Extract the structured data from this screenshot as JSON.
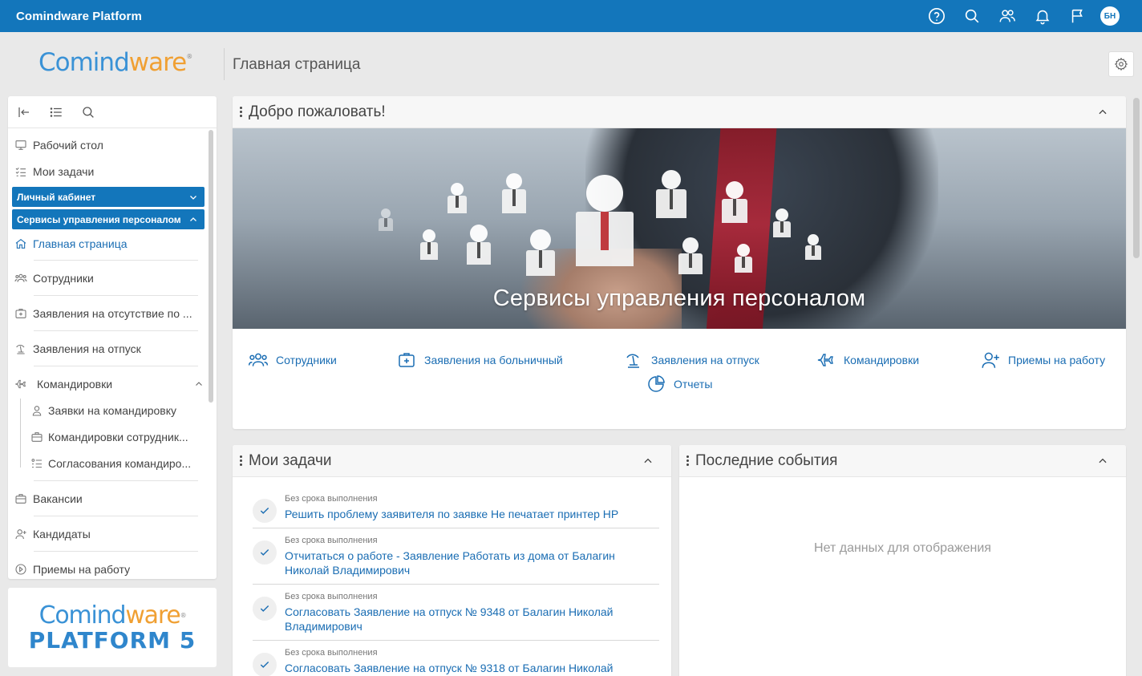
{
  "topbar": {
    "app_name": "Comindware Platform",
    "icons": [
      "help-icon",
      "search-icon",
      "users-icon",
      "bell-icon",
      "flag-icon"
    ],
    "avatar_initials": "БН"
  },
  "header": {
    "logo_part1": "Comind",
    "logo_part2": "ware",
    "logo_mark": "®",
    "page_title": "Главная страница"
  },
  "sidebar": {
    "items": [
      {
        "label": "Рабочий стол",
        "icon": "desktop-icon"
      },
      {
        "label": "Мои задачи",
        "icon": "tasks-icon"
      }
    ],
    "groups": [
      {
        "label": "Личный кабинет",
        "expanded": false
      },
      {
        "label": "Сервисы управления персоналом",
        "expanded": true
      }
    ],
    "hr_items": [
      {
        "label": "Главная страница",
        "icon": "home-icon",
        "active": true
      },
      {
        "label": "Сотрудники",
        "icon": "employees-icon"
      },
      {
        "label": "Заявления на отсутствие по ...",
        "icon": "sick-leave-icon"
      },
      {
        "label": "Заявления на отпуск",
        "icon": "vacation-icon"
      },
      {
        "label": "Командировки",
        "icon": "plane-icon"
      }
    ],
    "trip_sub": [
      {
        "label": "Заявки на командировку",
        "icon": "person-icon"
      },
      {
        "label": "Командировки сотрудник...",
        "icon": "briefcase-icon"
      },
      {
        "label": "Согласования командиро...",
        "icon": "approval-icon"
      }
    ],
    "tail_items": [
      {
        "label": "Вакансии",
        "icon": "vacancy-icon"
      },
      {
        "label": "Кандидаты",
        "icon": "candidate-icon"
      },
      {
        "label": "Приемы на работу",
        "icon": "hiring-icon"
      }
    ]
  },
  "bottom_logo": {
    "line1_a": "Comind",
    "line1_b": "ware",
    "mark": "®",
    "line2": "PLATFORM 5"
  },
  "welcome": {
    "title": "Добро пожаловать!",
    "banner_title": "Сервисы управления персоналом",
    "links": [
      {
        "label": "Сотрудники",
        "icon": "employees-icon"
      },
      {
        "label": "Заявления на больничный",
        "icon": "medical-icon"
      },
      {
        "label": "Заявления на отпуск",
        "icon": "vacation-icon"
      },
      {
        "label": "Командировки",
        "icon": "plane-icon"
      },
      {
        "label": "Приемы на работу",
        "icon": "add-user-icon"
      },
      {
        "label": "Отчеты",
        "icon": "pie-chart-icon"
      }
    ]
  },
  "tasks": {
    "title": "Мои задачи",
    "items": [
      {
        "meta": "Без срока выполнения",
        "text": "Решить проблему заявителя по заявке Не печатает принтер HP"
      },
      {
        "meta": "Без срока выполнения",
        "text": "Отчитаться о работе - Заявление Работать из дома от Балагин Николай Владимирович"
      },
      {
        "meta": "Без срока выполнения",
        "text": "Согласовать Заявление на отпуск № 9348 от Балагин Николай Владимирович"
      },
      {
        "meta": "Без срока выполнения",
        "text": "Согласовать Заявление на отпуск № 9318 от Балагин Николай"
      }
    ]
  },
  "events": {
    "title": "Последние события",
    "empty_text": "Нет данных для отображения"
  }
}
